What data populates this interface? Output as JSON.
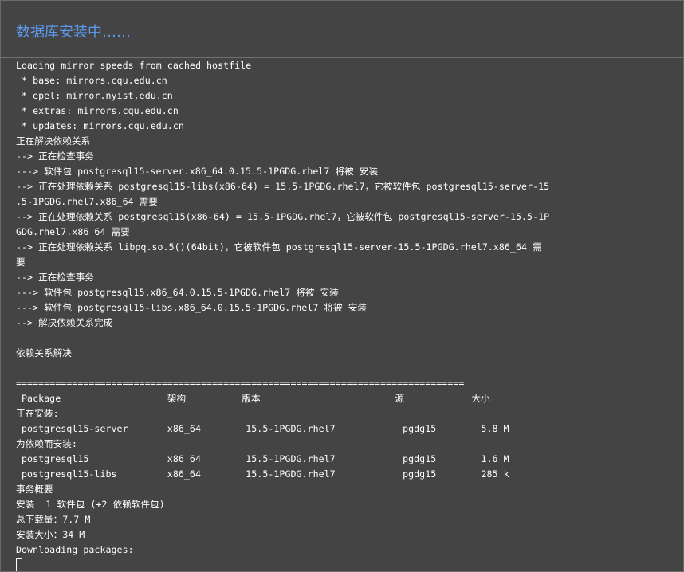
{
  "dialog": {
    "title": "数据库安装中……"
  },
  "terminal": {
    "lines": [
      "Loading mirror speeds from cached hostfile",
      " * base: mirrors.cqu.edu.cn",
      " * epel: mirror.nyist.edu.cn",
      " * extras: mirrors.cqu.edu.cn",
      " * updates: mirrors.cqu.edu.cn",
      "正在解决依赖关系",
      "--> 正在检查事务",
      "---> 软件包 postgresql15-server.x86_64.0.15.5-1PGDG.rhel7 将被 安装",
      "--> 正在处理依赖关系 postgresql15-libs(x86-64) = 15.5-1PGDG.rhel7，它被软件包 postgresql15-server-15",
      ".5-1PGDG.rhel7.x86_64 需要",
      "--> 正在处理依赖关系 postgresql15(x86-64) = 15.5-1PGDG.rhel7，它被软件包 postgresql15-server-15.5-1P",
      "GDG.rhel7.x86_64 需要",
      "--> 正在处理依赖关系 libpq.so.5()(64bit)，它被软件包 postgresql15-server-15.5-1PGDG.rhel7.x86_64 需",
      "要",
      "--> 正在检查事务",
      "---> 软件包 postgresql15.x86_64.0.15.5-1PGDG.rhel7 将被 安装",
      "---> 软件包 postgresql15-libs.x86_64.0.15.5-1PGDG.rhel7 将被 安装",
      "--> 解决依赖关系完成",
      "",
      "依赖关系解决",
      "",
      "================================================================================",
      " Package                   架构          版本                        源            大小",
      "正在安装:",
      " postgresql15-server       x86_64        15.5-1PGDG.rhel7            pgdg15        5.8 M",
      "为依赖而安装:",
      " postgresql15              x86_64        15.5-1PGDG.rhel7            pgdg15        1.6 M",
      " postgresql15-libs         x86_64        15.5-1PGDG.rhel7            pgdg15        285 k",
      "事务概要",
      "安装  1 软件包 (+2 依赖软件包)",
      "总下载量：7.7 M",
      "安装大小：34 M",
      "Downloading packages:"
    ]
  }
}
